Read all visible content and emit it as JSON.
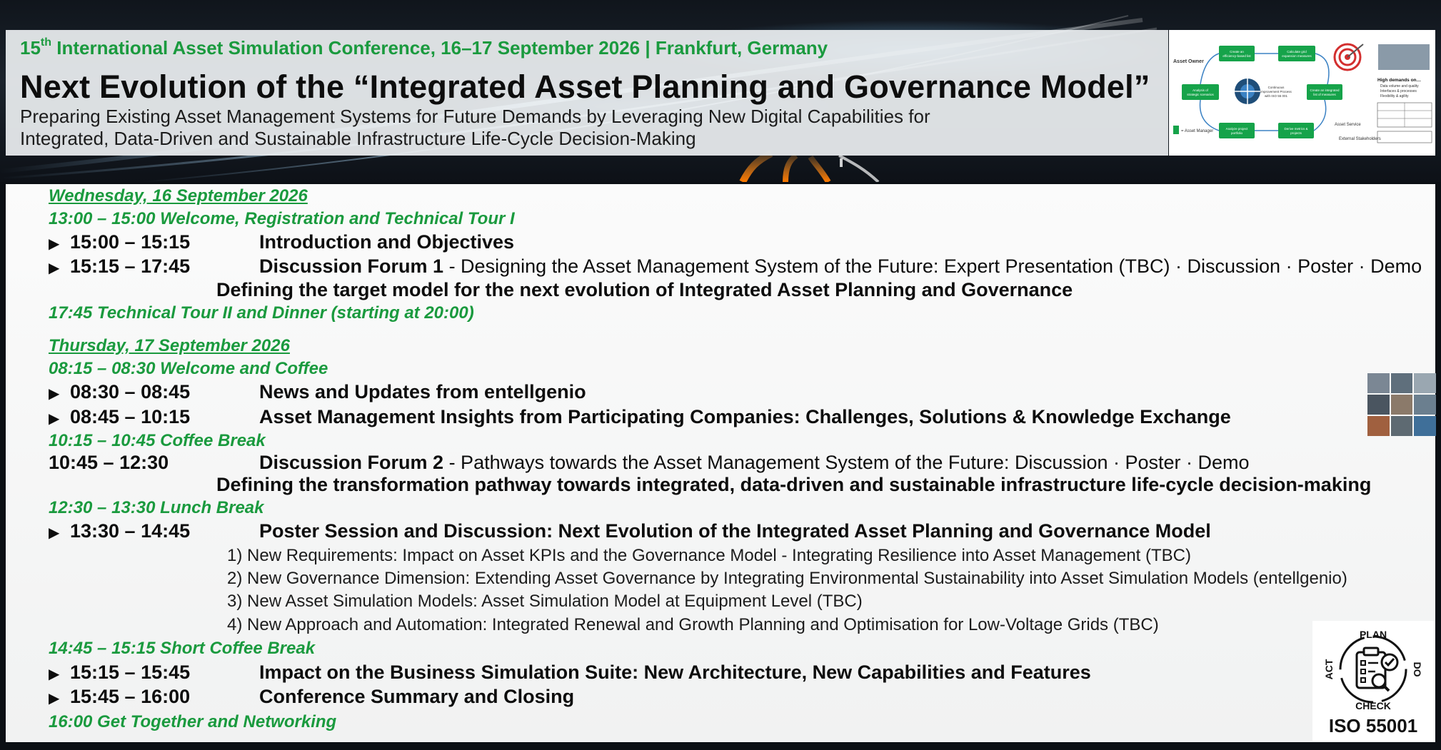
{
  "header": {
    "conference_prefix": "15",
    "conference_sup": "th",
    "conference_rest": " International Asset Simulation Conference, 16–17 September 2026 | Frankfurt, Germany",
    "title": "Next Evolution of the “Integrated Asset Planning and Governance Model”",
    "subtitle_line1": "Preparing Existing Asset Management Systems for Future Demands by Leveraging New Digital Capabilities for",
    "subtitle_line2": "Integrated, Data-Driven and Sustainable Infrastructure Life-Cycle Decision-Making"
  },
  "diagram": {
    "asset_owner": "Asset Owner",
    "box1": "Create an efficiency-based list of measures",
    "box2": "Calculate grid expansion/growth measures",
    "box3": "Analysis of strategic scenarios",
    "center": "Continuous Improvement Process in line with ISO 55 001",
    "box4": "Create an integrated list of measures",
    "box5": "Analyze project portfolio",
    "box6": "Derive metrics & projects",
    "asset_manager": "= Asset Manager",
    "asset_service": "Asset Service",
    "external": "External Stakeholders",
    "high_demands": "High demands on…",
    "bullet1": "Data volume and quality",
    "bullet2": "Interfaces & processes",
    "bullet3": "Flexibility & agility"
  },
  "day1": {
    "date": "Wednesday, 16 September 2026",
    "welcome": "13:00 – 15:00 Welcome, Registration and Technical Tour I",
    "s1_time": "15:00 – 15:15",
    "s1_title": "Introduction and Objectives",
    "s2_time": "15:15 – 17:45",
    "s2_title": "Discussion Forum 1",
    "s2_desc": " - Designing the Asset Management System of the Future: Expert Presentation (TBC) · Discussion · Poster · Demo",
    "s2_line2": "Defining the target model for the next evolution of Integrated Asset Planning and Governance",
    "evening": "17:45 Technical Tour II and Dinner (starting at 20:00)"
  },
  "day2": {
    "date": "Thursday, 17 September 2026",
    "welcome": "08:15 – 08:30 Welcome and Coffee",
    "s1_time": "08:30 – 08:45",
    "s1_title": "News and Updates from entellgenio",
    "s2_time": "08:45 – 10:15",
    "s2_title": "Asset Management Insights from Participating Companies: Challenges, Solutions & Knowledge Exchange",
    "break1": "10:15 – 10:45 Coffee Break",
    "s3_time": "10:45 – 12:30",
    "s3_title": "Discussion Forum 2",
    "s3_desc": " - Pathways towards the Asset Management System of the Future: Discussion · Poster · Demo",
    "s3_line2": "Defining the transformation pathway towards integrated, data-driven and sustainable infrastructure life-cycle decision-making",
    "lunch": "12:30 – 13:30 Lunch Break",
    "s4_time": "13:30 – 14:45",
    "s4_title": "Poster Session and Discussion: Next Evolution of the Integrated Asset Planning and Governance Model",
    "posters": [
      "1) New Requirements: Impact on Asset KPIs and the Governance Model - Integrating Resilience into Asset Management (TBC)",
      "2) New Governance Dimension: Extending Asset Governance by Integrating Environmental Sustainability into Asset Simulation Models (entellgenio)",
      "3) New Asset Simulation Models: Asset Simulation Model at Equipment Level (TBC)",
      "4) New Approach and Automation: Integrated Renewal and Growth Planning and Optimisation for Low-Voltage Grids (TBC)"
    ],
    "break2": "14:45 – 15:15 Short Coffee Break",
    "s5_time": "15:15 – 15:45",
    "s5_title": "Impact on the Business Simulation Suite: New Architecture, New Capabilities and Features",
    "s6_time": "15:45 – 16:00",
    "s6_title": "Conference Summary and Closing",
    "closing": "16:00  Get Together and Networking"
  },
  "iso": {
    "plan": "PLAN",
    "do": "DO",
    "check": "CHECK",
    "act": "ACT",
    "label": "ISO 55001"
  },
  "colors": {
    "accent_green": "#1a9a3e",
    "diagram_green": "#16a34a",
    "text_dark": "#0d0d0d"
  },
  "icons": {
    "arrow": "▶"
  }
}
